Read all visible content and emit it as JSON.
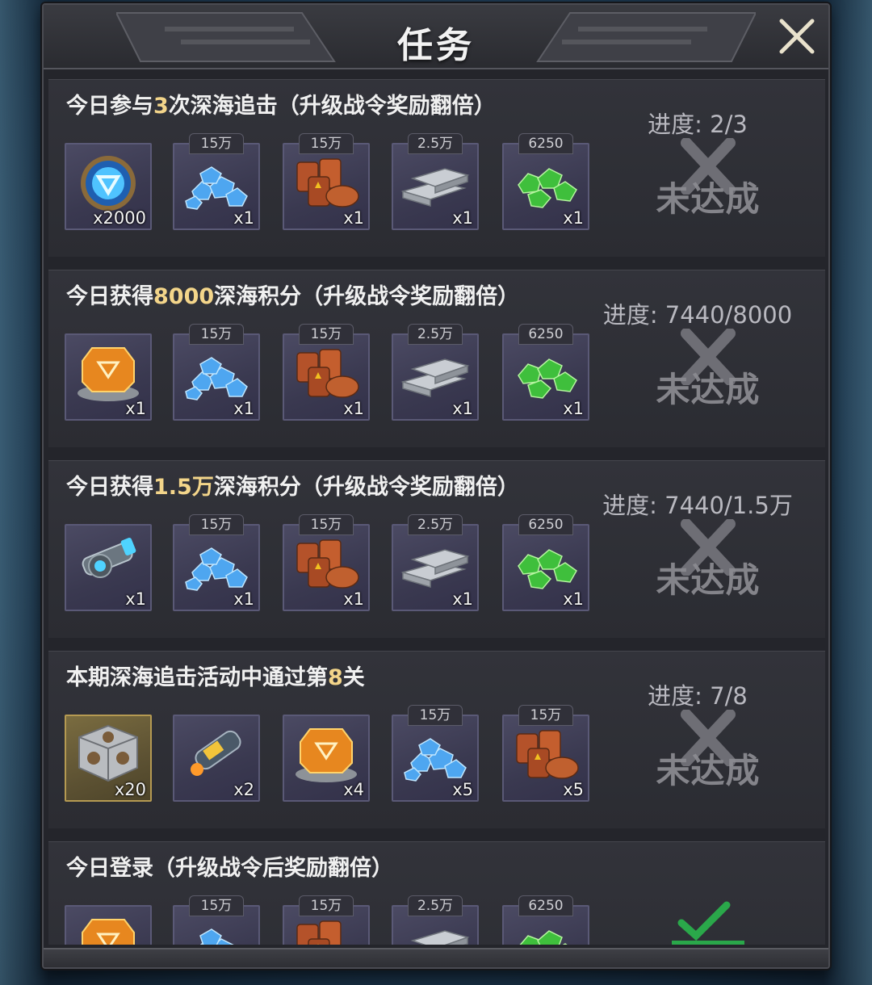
{
  "window": {
    "title": "任务",
    "close_icon": "close-icon"
  },
  "tasks": [
    {
      "title_pre": "今日参与",
      "title_hl": "3",
      "title_post": "次深海追击（升级战令奖励翻倍）",
      "progress": "进度: 2/3",
      "status": "未达成",
      "rewards": [
        {
          "icon": "blue-emblem-coin",
          "tag": "",
          "qty": "x2000"
        },
        {
          "icon": "blue-crystals",
          "tag": "15万",
          "qty": "x1"
        },
        {
          "icon": "oil-barrels",
          "tag": "15万",
          "qty": "x1"
        },
        {
          "icon": "steel-ingots",
          "tag": "2.5万",
          "qty": "x1"
        },
        {
          "icon": "green-gems",
          "tag": "6250",
          "qty": "x1"
        }
      ]
    },
    {
      "title_pre": "今日获得",
      "title_hl": "8000",
      "title_post": "深海积分（升级战令奖励翻倍）",
      "progress": "进度: 7440/8000",
      "status": "未达成",
      "rewards": [
        {
          "icon": "orange-core-device",
          "tag": "",
          "qty": "x1"
        },
        {
          "icon": "blue-crystals",
          "tag": "15万",
          "qty": "x1"
        },
        {
          "icon": "oil-barrels",
          "tag": "15万",
          "qty": "x1"
        },
        {
          "icon": "steel-ingots",
          "tag": "2.5万",
          "qty": "x1"
        },
        {
          "icon": "green-gems",
          "tag": "6250",
          "qty": "x1"
        }
      ]
    },
    {
      "title_pre": "今日获得",
      "title_hl": "1.5万",
      "title_post": "深海积分（升级战令奖励翻倍）",
      "progress": "进度: 7440/1.5万",
      "status": "未达成",
      "rewards": [
        {
          "icon": "cannon-module",
          "tag": "",
          "qty": "x1"
        },
        {
          "icon": "blue-crystals",
          "tag": "15万",
          "qty": "x1"
        },
        {
          "icon": "oil-barrels",
          "tag": "15万",
          "qty": "x1"
        },
        {
          "icon": "steel-ingots",
          "tag": "2.5万",
          "qty": "x1"
        },
        {
          "icon": "green-gems",
          "tag": "6250",
          "qty": "x1"
        }
      ]
    },
    {
      "title_pre": "本期深海追击活动中通过第",
      "title_hl": "8",
      "title_post": "关",
      "progress": "进度: 7/8",
      "status": "未达成",
      "rewards": [
        {
          "icon": "metal-cube",
          "tag": "",
          "qty": "x20"
        },
        {
          "icon": "fuel-canister",
          "tag": "",
          "qty": "x2"
        },
        {
          "icon": "orange-core-device",
          "tag": "",
          "qty": "x4"
        },
        {
          "icon": "blue-crystals",
          "tag": "15万",
          "qty": "x5"
        },
        {
          "icon": "oil-barrels",
          "tag": "15万",
          "qty": "x5"
        }
      ]
    },
    {
      "title_pre": "今日登录（升级战令后奖励翻倍）",
      "title_hl": "",
      "title_post": "",
      "progress": "",
      "status": "",
      "rewards": [
        {
          "icon": "orange-core-device",
          "tag": "",
          "qty": ""
        },
        {
          "icon": "blue-crystals",
          "tag": "15万",
          "qty": ""
        },
        {
          "icon": "oil-barrels",
          "tag": "15万",
          "qty": ""
        },
        {
          "icon": "steel-ingots",
          "tag": "2.5万",
          "qty": ""
        },
        {
          "icon": "green-gems",
          "tag": "6250",
          "qty": ""
        }
      ]
    }
  ],
  "colors": {
    "highlight": "#f3d58a",
    "panel": "#24252b",
    "item_bg": "#3a3950",
    "status_gray": "#8c8c92",
    "complete_green": "#2aa84a"
  }
}
